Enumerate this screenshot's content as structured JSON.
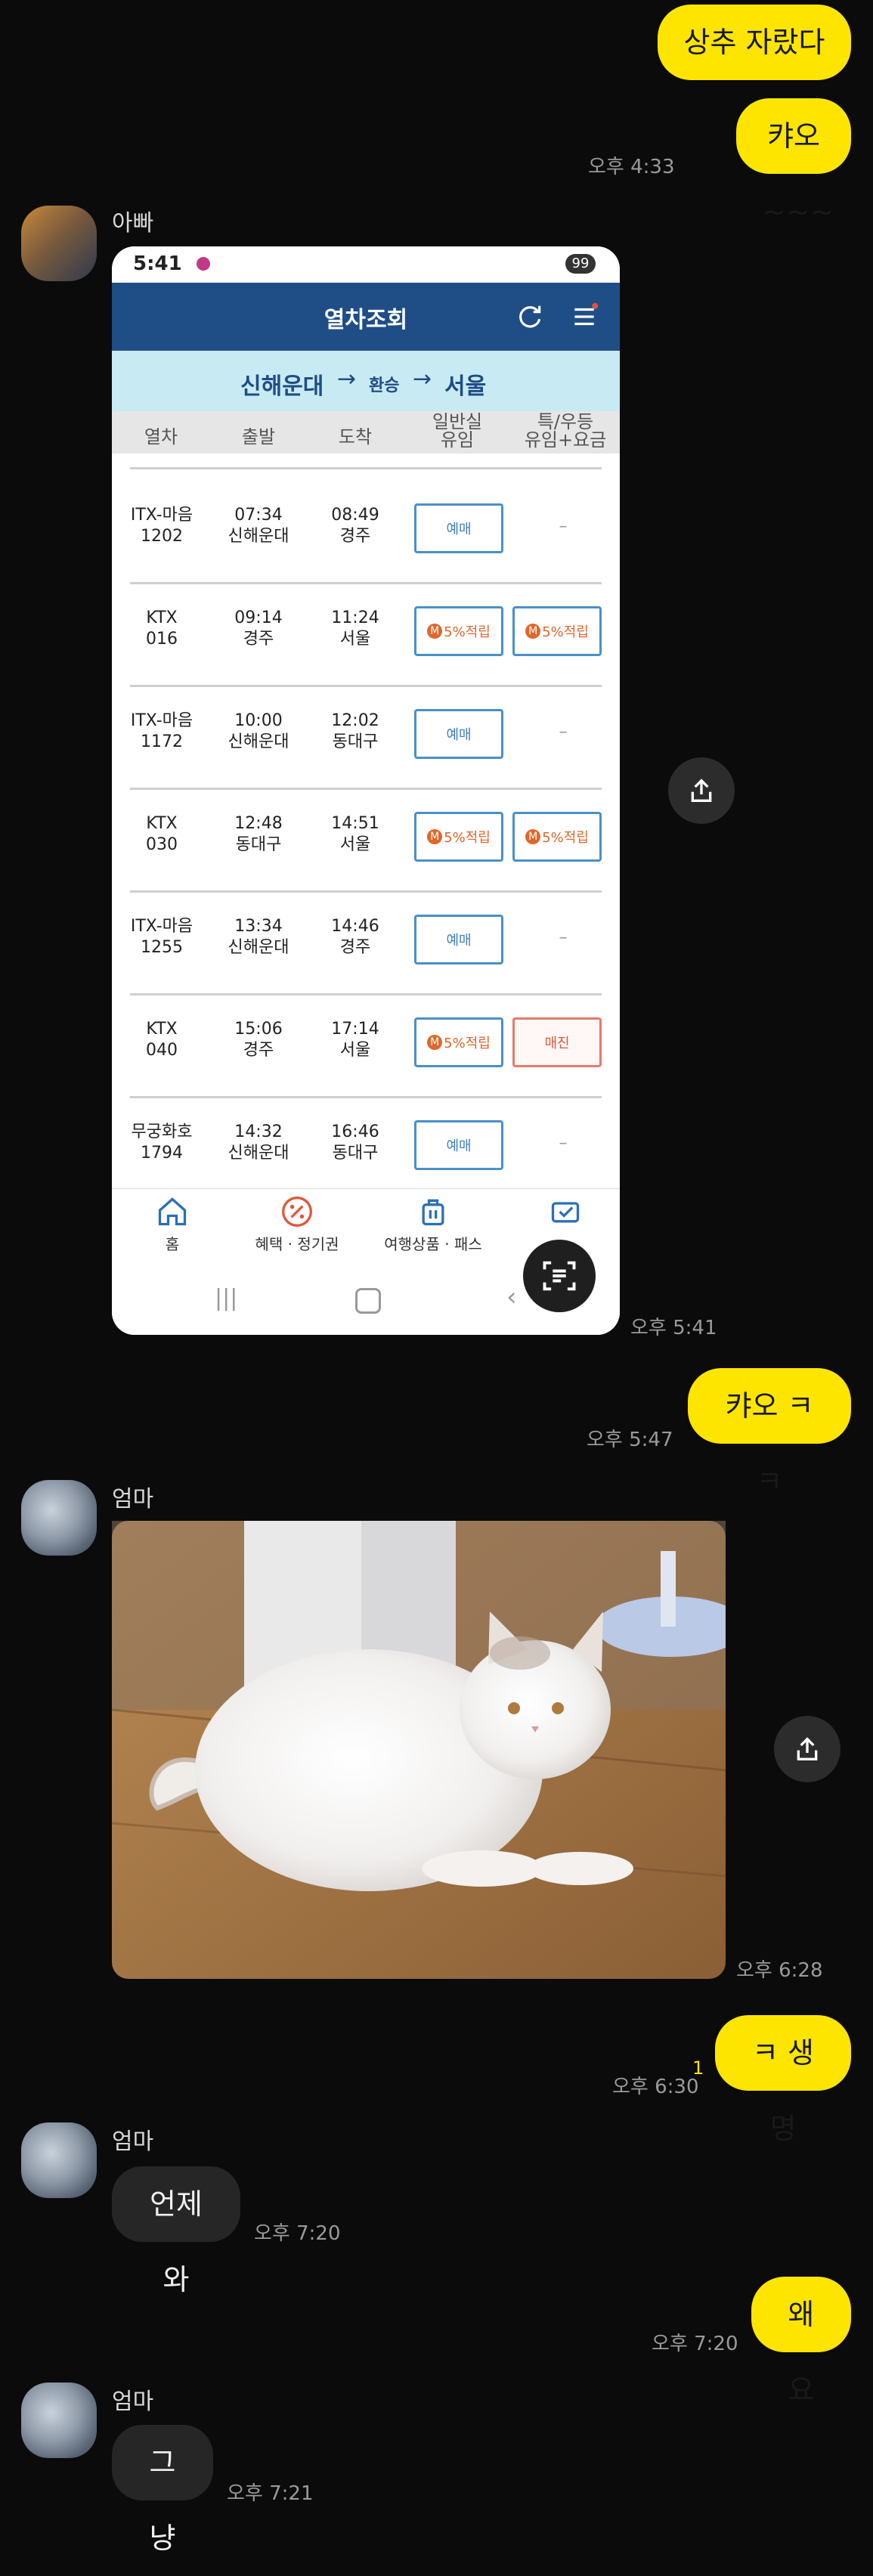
{
  "messages": {
    "m1": {
      "text": "상추 자랐다"
    },
    "m2": {
      "text": "캬오~~~",
      "time": "오후 4:33"
    },
    "dad": {
      "sender": "아빠",
      "time": "오후 5:41"
    },
    "m3": {
      "text": "캬오 ㅋㅋ",
      "time": "오후 5:47"
    },
    "mom1": {
      "sender": "엄마",
      "time": "오후 6:28"
    },
    "m4": {
      "text": "ㅋ 생명",
      "time": "오후 6:30",
      "unread": "1"
    },
    "mom2": {
      "sender": "엄마",
      "text": "언제와",
      "time": "오후 7:20"
    },
    "m5": {
      "text": "왜요",
      "time": "오후 7:20"
    },
    "mom3": {
      "sender": "엄마",
      "text": "그냥",
      "time": "오후 7:21"
    }
  },
  "phone": {
    "status": {
      "time": "5:41",
      "battery": "99"
    },
    "header_title": "열차조회",
    "route": {
      "from": "신해운대",
      "via": "환승",
      "to": "서울"
    },
    "columns": [
      "열차",
      "출발",
      "도착",
      "일반실\n유임",
      "특/우등\n유임+요금"
    ],
    "rows": [
      {
        "train": "ITX-마음",
        "num": "1202",
        "dep_time": "07:34",
        "dep_st": "신해운대",
        "arr_time": "08:49",
        "arr_st": "경주",
        "general": "예매",
        "special": "–"
      },
      {
        "train": "KTX",
        "num": "016",
        "dep_time": "09:14",
        "dep_st": "경주",
        "arr_time": "11:24",
        "arr_st": "서울",
        "general": "5%적립",
        "special": "5%적립"
      },
      {
        "train": "ITX-마음",
        "num": "1172",
        "dep_time": "10:00",
        "dep_st": "신해운대",
        "arr_time": "12:02",
        "arr_st": "동대구",
        "general": "예매",
        "special": "–"
      },
      {
        "train": "KTX",
        "num": "030",
        "dep_time": "12:48",
        "dep_st": "동대구",
        "arr_time": "14:51",
        "arr_st": "서울",
        "general": "5%적립",
        "special": "5%적립"
      },
      {
        "train": "ITX-마음",
        "num": "1255",
        "dep_time": "13:34",
        "dep_st": "신해운대",
        "arr_time": "14:46",
        "arr_st": "경주",
        "general": "예매",
        "special": "–"
      },
      {
        "train": "KTX",
        "num": "040",
        "dep_time": "15:06",
        "dep_st": "경주",
        "arr_time": "17:14",
        "arr_st": "서울",
        "general": "5%적립",
        "special": "매진"
      },
      {
        "train": "무궁화호",
        "num": "1794",
        "dep_time": "14:32",
        "dep_st": "신해운대",
        "arr_time": "16:46",
        "arr_st": "동대구",
        "general": "예매",
        "special": "–"
      }
    ],
    "badge_letter": "M",
    "nav": {
      "home": "홈",
      "benefit": "혜택 · 정기권",
      "travel": "여행상품 · 패스"
    }
  },
  "icons": {
    "share": "share-icon",
    "scan": "text-scan-icon"
  },
  "colors": {
    "my_bubble": "#fee500",
    "other_bubble": "#262626",
    "background": "#0b0b0b",
    "app_header": "#1f4d86"
  }
}
